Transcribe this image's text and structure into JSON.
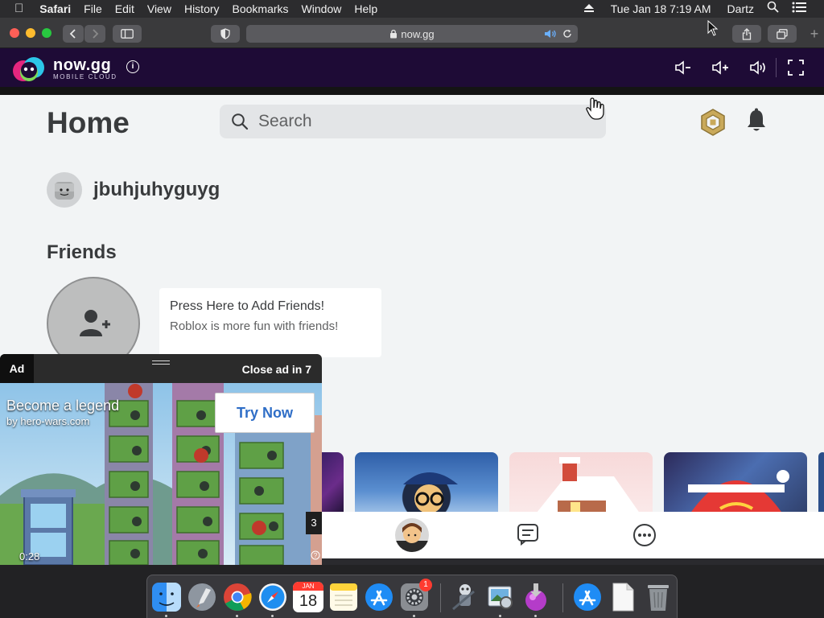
{
  "menubar": {
    "app": "Safari",
    "menus": [
      "File",
      "Edit",
      "View",
      "History",
      "Bookmarks",
      "Window",
      "Help"
    ],
    "datetime": "Tue Jan 18  7:19 AM",
    "user": "Dartz"
  },
  "browser": {
    "url": "now.gg",
    "secure_icon": "lock-icon"
  },
  "nowgg": {
    "brand": "now.gg",
    "tagline": "MOBILE CLOUD",
    "info_glyph": "i"
  },
  "roblox": {
    "title": "Home",
    "search_placeholder": "Search",
    "username": "jbuhjuhyguyg",
    "friends_heading": "Friends",
    "add_friends_title": "Press Here to Add Friends!",
    "add_friends_body": "Roblox is more fun with friends!"
  },
  "ad": {
    "badge": "Ad",
    "close_label": "Close ad in 7",
    "headline": "Become a legend",
    "source": "by hero-wars.com",
    "cta": "Try Now",
    "timer": "0:28",
    "carousel_index": "3"
  },
  "dock": {
    "apps": [
      "finder",
      "launchpad",
      "chrome",
      "safari",
      "calendar",
      "notes",
      "app-store",
      "system-preferences",
      "automator",
      "preview",
      "installer",
      "app-store-alt",
      "document",
      "trash"
    ],
    "calendar_month": "JAN",
    "calendar_day": "18",
    "system_prefs_badge": "1"
  },
  "colors": {
    "nowgg_header": "#1e0b36",
    "roblox_bg": "#f2f4f5",
    "cta_text": "#2f6ec7"
  }
}
